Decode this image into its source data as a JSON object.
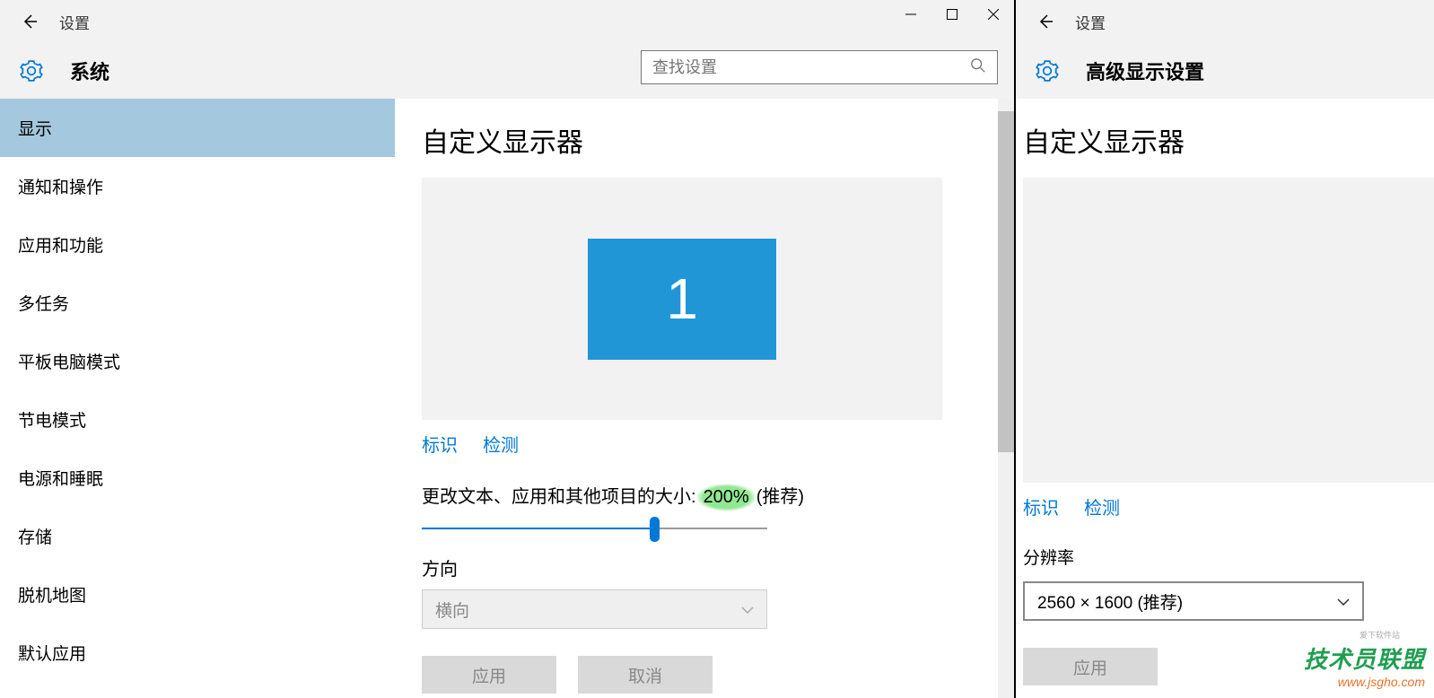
{
  "left": {
    "titlebar": {
      "title": "设置"
    },
    "header": {
      "title": "系统",
      "search_placeholder": "查找设置"
    },
    "sidebar": {
      "items": [
        {
          "label": "显示",
          "active": true
        },
        {
          "label": "通知和操作"
        },
        {
          "label": "应用和功能"
        },
        {
          "label": "多任务"
        },
        {
          "label": "平板电脑模式"
        },
        {
          "label": "节电模式"
        },
        {
          "label": "电源和睡眠"
        },
        {
          "label": "存储"
        },
        {
          "label": "脱机地图"
        },
        {
          "label": "默认应用"
        }
      ]
    },
    "content": {
      "h1": "自定义显示器",
      "monitor_number": "1",
      "link_identify": "标识",
      "link_detect": "检测",
      "size_label_prefix": "更改文本、应用和其他项目的大小: ",
      "size_value": "200%",
      "size_recommended": " (推荐)",
      "orientation_label": "方向",
      "orientation_value": "横向",
      "apply_label": "应用",
      "cancel_label": "取消"
    }
  },
  "right": {
    "titlebar": {
      "title": "设置"
    },
    "header": {
      "title": "高级显示设置"
    },
    "content": {
      "h1": "自定义显示器",
      "link_identify": "标识",
      "link_detect": "检测",
      "resolution_label": "分辨率",
      "resolution_value": "2560 × 1600 (推荐)",
      "apply_label": "应用"
    }
  },
  "watermark": {
    "top": "技术员联盟",
    "bottom": "www.jsgho.com",
    "small": "爱下软件站"
  }
}
